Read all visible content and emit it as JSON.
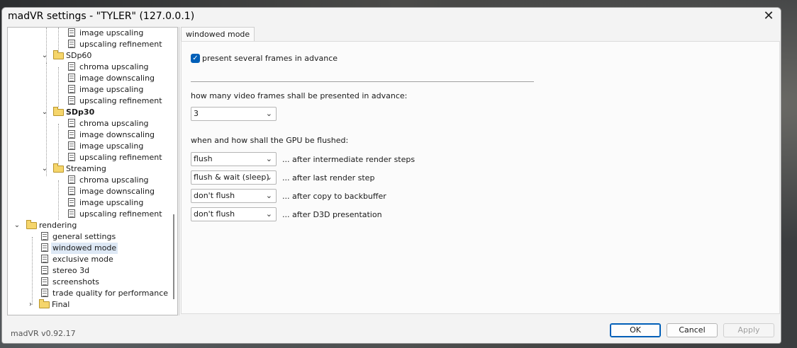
{
  "window": {
    "title": "madVR settings - \"TYLER\" (127.0.0.1)"
  },
  "tree": {
    "rows": [
      {
        "label": "image upscaling",
        "icon": "page"
      },
      {
        "label": "upscaling refinement",
        "icon": "page"
      },
      {
        "label": "SDp60",
        "icon": "folder",
        "toggle": "⌄"
      },
      {
        "label": "chroma upscaling",
        "icon": "page"
      },
      {
        "label": "image downscaling",
        "icon": "page"
      },
      {
        "label": "image upscaling",
        "icon": "page"
      },
      {
        "label": "upscaling refinement",
        "icon": "page"
      },
      {
        "label": "SDp30",
        "icon": "folder",
        "toggle": "⌄"
      },
      {
        "label": "chroma upscaling",
        "icon": "page"
      },
      {
        "label": "image downscaling",
        "icon": "page"
      },
      {
        "label": "image upscaling",
        "icon": "page"
      },
      {
        "label": "upscaling refinement",
        "icon": "page"
      },
      {
        "label": "Streaming",
        "icon": "folder",
        "toggle": "⌄"
      },
      {
        "label": "chroma upscaling",
        "icon": "page"
      },
      {
        "label": "image downscaling",
        "icon": "page"
      },
      {
        "label": "image upscaling",
        "icon": "page"
      },
      {
        "label": "upscaling refinement",
        "icon": "page"
      },
      {
        "label": "rendering",
        "icon": "folder",
        "toggle": "⌄"
      },
      {
        "label": "general settings",
        "icon": "page"
      },
      {
        "label": "windowed mode",
        "icon": "page"
      },
      {
        "label": "exclusive mode",
        "icon": "page"
      },
      {
        "label": "stereo 3d",
        "icon": "page"
      },
      {
        "label": "screenshots",
        "icon": "page"
      },
      {
        "label": "trade quality for performance",
        "icon": "page"
      },
      {
        "label": "Final",
        "icon": "folder",
        "toggle": "›"
      }
    ]
  },
  "tab": {
    "label": "windowed mode"
  },
  "settings": {
    "present_frames_label": "present several frames in advance",
    "present_frames_checked": true,
    "frames_question": "how many video frames shall be presented in advance:",
    "frames_value": "3",
    "flush_question": "when and how shall the GPU be flushed:",
    "flush_rows": [
      {
        "value": "flush",
        "desc": "... after intermediate render steps"
      },
      {
        "value": "flush & wait (sleep)",
        "desc": "... after last render step"
      },
      {
        "value": "don't flush",
        "desc": "... after copy to backbuffer"
      },
      {
        "value": "don't flush",
        "desc": "... after D3D presentation"
      }
    ]
  },
  "footer": {
    "version": "madVR v0.92.17",
    "ok_label": "OK",
    "cancel_label": "Cancel",
    "apply_label": "Apply"
  }
}
